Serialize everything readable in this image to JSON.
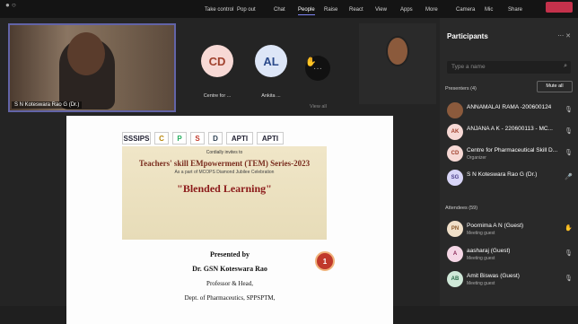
{
  "toolbar": {
    "timer": "",
    "items": [
      "Take control",
      "Pop out",
      "Chat",
      "People",
      "Raise",
      "React",
      "View",
      "Apps",
      "More",
      "Camera",
      "Mic",
      "Share"
    ],
    "active": "People"
  },
  "video": {
    "label": "S N Koteswara Rao G (Dr.)"
  },
  "tiles": [
    {
      "initials": "CD",
      "name": "Centre for ...",
      "color": "#f7d9d5",
      "text": "#a0412d"
    },
    {
      "initials": "AL",
      "name": "Ankita ...",
      "color": "#dde6f7",
      "text": "#2b4a8b"
    }
  ],
  "view_all": "View all",
  "slide": {
    "logos": [
      "SSSIPS",
      "C",
      "P",
      "S",
      "D",
      "APTI",
      "APTI"
    ],
    "subtitle1": "Cordially invites to",
    "title1": "Teachers' skill EMpowerment (TEM) Series-2023",
    "subtitle2": "As a part of MCOPS Diamond Jubilee Celebration",
    "title2": "\"Blended Learning\"",
    "medal": "1",
    "presented_by": "Presented by",
    "presenter": "Dr. GSN Koteswara Rao",
    "role": "Professor & Head,",
    "dept": "Dept. of Pharmaceutics, SPPSPTM,"
  },
  "panel": {
    "title": "Participants",
    "search_placeholder": "Type a name",
    "presenters_label": "Presenters (4)",
    "mute_all": "Mute all",
    "attendees_label": "Attendees (59)",
    "presenters": [
      {
        "initials": "",
        "name": "ANNAMALAI RAMA -200600124",
        "role": "",
        "color": "#8b5a3c"
      },
      {
        "initials": "AK",
        "name": "ANJANA A K - 220600113 - MC...",
        "role": "",
        "color": "#f7d9d5"
      },
      {
        "initials": "CD",
        "name": "Centre for Pharmaceutical Skill D...",
        "role": "Organizer",
        "color": "#f7d9d5"
      },
      {
        "initials": "SG",
        "name": "S N Koteswara Rao G (Dr.)",
        "role": "",
        "color": "#d8d5f7"
      }
    ],
    "attendees": [
      {
        "initials": "PN",
        "name": "Poornima A N (Guest)",
        "role": "Meeting guest",
        "color": "#f0dfc8"
      },
      {
        "initials": "A",
        "name": "aasharaj (Guest)",
        "role": "Meeting guest",
        "color": "#f5d7e6"
      },
      {
        "initials": "AB",
        "name": "Amit Biswas (Guest)",
        "role": "Meeting guest",
        "color": "#cfe8d8"
      }
    ]
  }
}
